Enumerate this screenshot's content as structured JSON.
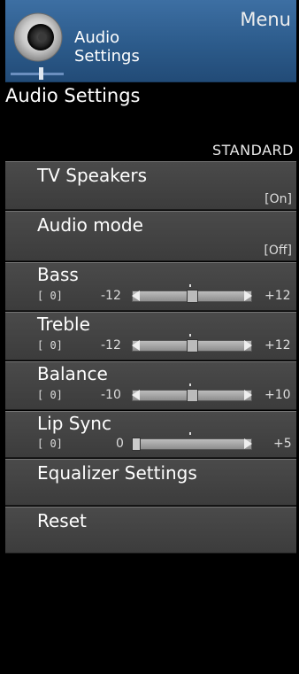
{
  "header": {
    "title_line1": "Audio",
    "title_line2": "Settings",
    "menu_label": "Menu",
    "icon": "speaker-icon"
  },
  "page_title": "Audio Settings",
  "mode_label": "STANDARD",
  "items": [
    {
      "label": "TV Speakers",
      "value": "[On]"
    },
    {
      "label": "Audio mode",
      "value": "[Off]"
    },
    {
      "label": "Bass",
      "bracket": "[   0]",
      "min": "-12",
      "max": "+12",
      "level": 0.5
    },
    {
      "label": "Treble",
      "bracket": "[   0]",
      "min": "-12",
      "max": "+12",
      "level": 0.5
    },
    {
      "label": "Balance",
      "bracket": "[   0]",
      "min": "-10",
      "max": "+10",
      "level": 0.5
    },
    {
      "label": "Lip Sync",
      "bracket": "[   0]",
      "min": "0",
      "max": "+5",
      "level": 0.0
    },
    {
      "label": "Equalizer Settings"
    },
    {
      "label": "Reset"
    }
  ],
  "colors": {
    "header_blue": "#2c5b8b",
    "item_gray": "#444444",
    "background": "#000000"
  }
}
